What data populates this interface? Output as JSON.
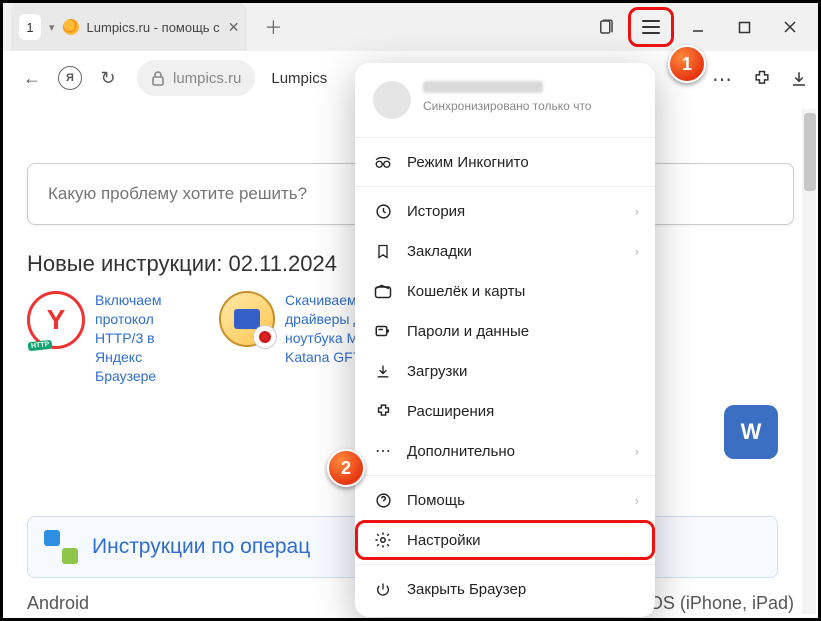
{
  "window": {
    "tab_number": "1",
    "tab_title": "Lumpics.ru - помощь с",
    "url_host": "lumpics.ru",
    "page_title_inbar": "Lumpics"
  },
  "page": {
    "search_placeholder": "Какую проблему хотите решить?",
    "new_heading": "Новые инструкции: 02.11.2024",
    "card1": "Включаем протокол HTTP/3 в Яндекс Браузере",
    "card2": "Скачиваем драйверы для ноутбука MSI Katana GF76",
    "os_link": "Инструкции по операц",
    "vk": "W",
    "foot_left": "Android",
    "foot_right": "iOS (iPhone, iPad)"
  },
  "menu": {
    "sync": "Синхронизировано только что",
    "incognito": "Режим Инкогнито",
    "history": "История",
    "bookmarks": "Закладки",
    "wallet": "Кошелёк и карты",
    "passwords": "Пароли и данные",
    "downloads": "Загрузки",
    "extensions": "Расширения",
    "more": "Дополнительно",
    "help": "Помощь",
    "settings": "Настройки",
    "close": "Закрыть Браузер"
  },
  "markers": {
    "m1": "1",
    "m2": "2"
  }
}
